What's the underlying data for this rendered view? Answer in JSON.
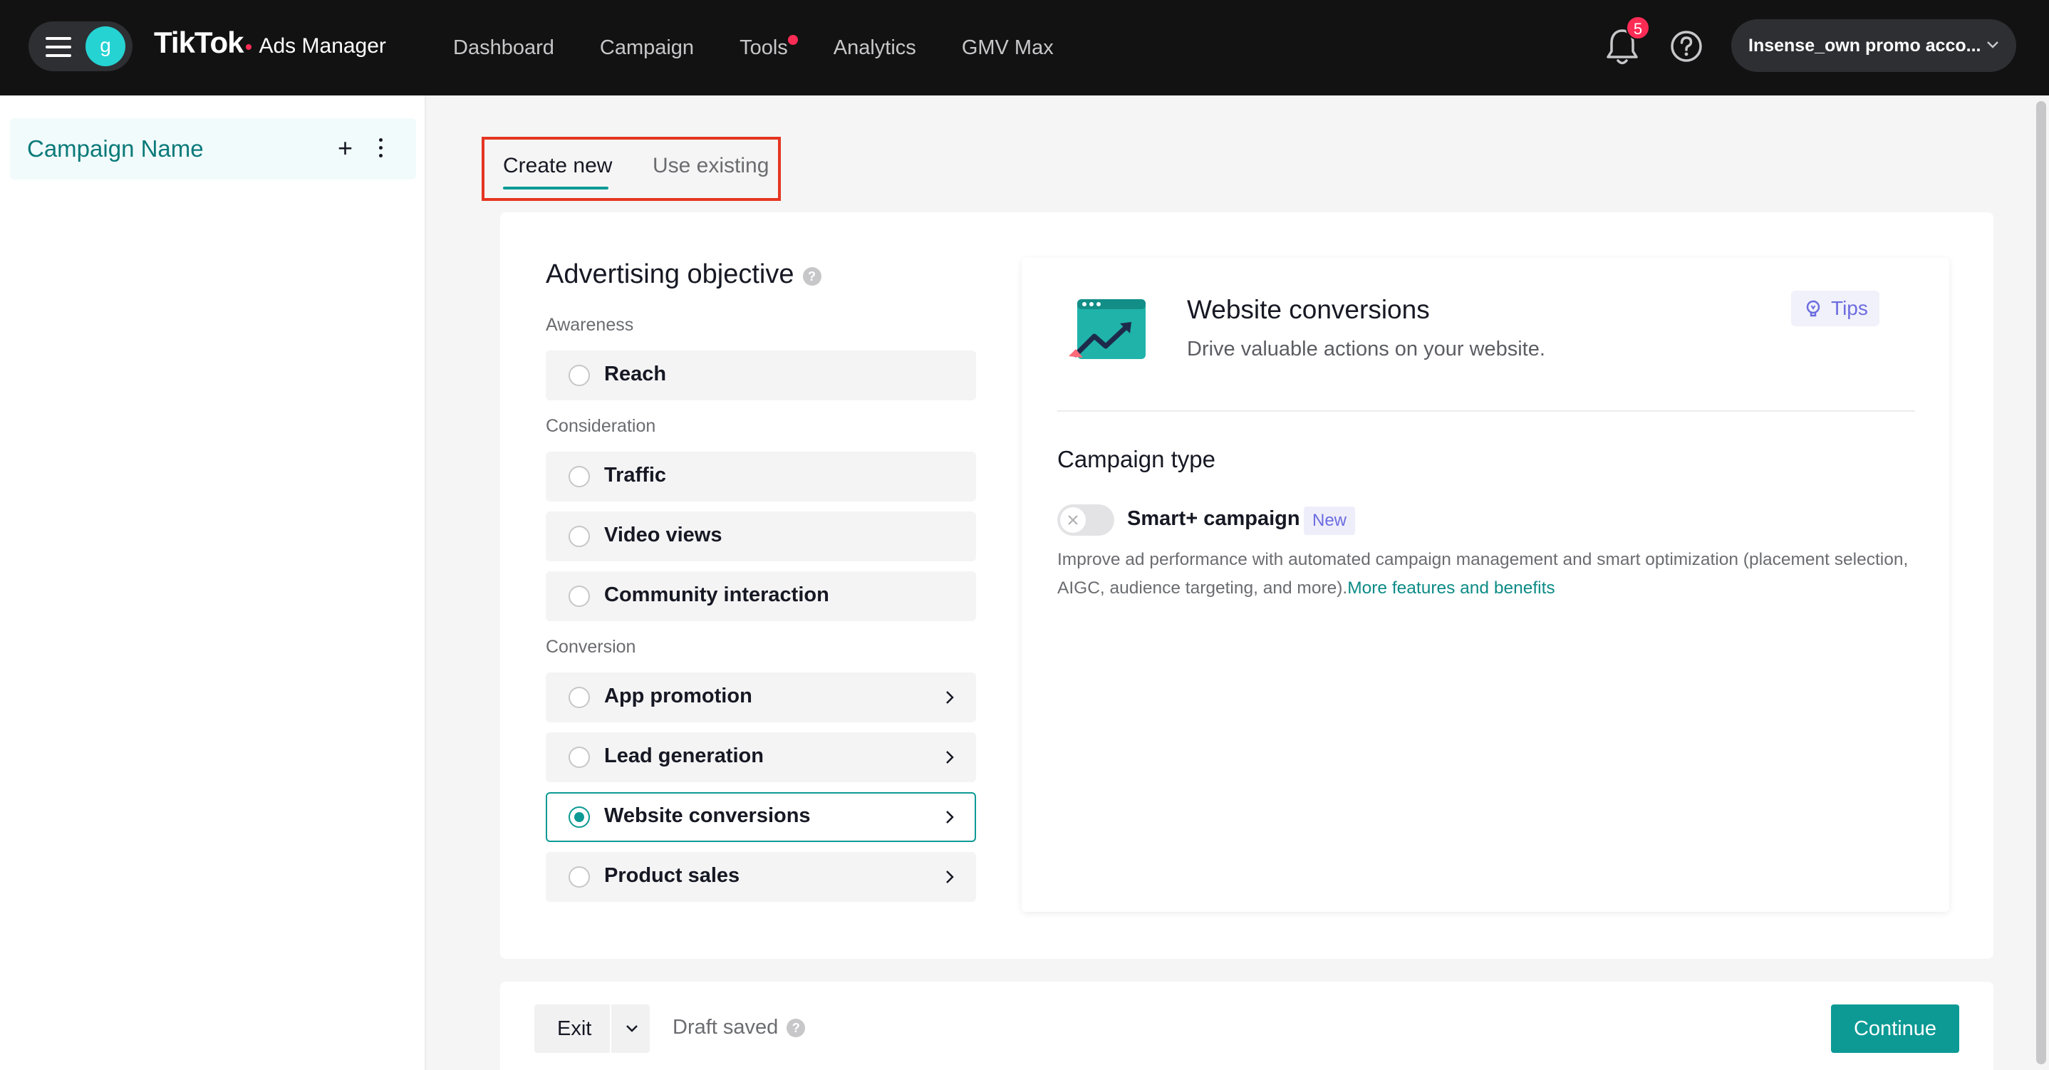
{
  "topbar": {
    "avatar_letter": "g",
    "brand_main": "TikTok",
    "brand_sub": "Ads Manager",
    "nav": [
      {
        "label": "Dashboard"
      },
      {
        "label": "Campaign"
      },
      {
        "label": "Tools",
        "dot": true
      },
      {
        "label": "Analytics"
      },
      {
        "label": "GMV Max"
      }
    ],
    "notification_count": "5",
    "account_label": "Insense_own promo acco..."
  },
  "sidebar": {
    "campaign_name": "Campaign Name",
    "add_symbol": "+"
  },
  "tabs": {
    "create_new": "Create new",
    "use_existing": "Use existing"
  },
  "objective": {
    "title": "Advertising objective",
    "help_symbol": "?",
    "groups": {
      "awareness": "Awareness",
      "consideration": "Consideration",
      "conversion": "Conversion"
    },
    "options": {
      "reach": "Reach",
      "traffic": "Traffic",
      "video_views": "Video views",
      "community_interaction": "Community interaction",
      "app_promotion": "App promotion",
      "lead_generation": "Lead generation",
      "website_conversions": "Website conversions",
      "product_sales": "Product sales"
    },
    "selected": "Website conversions"
  },
  "detail": {
    "title": "Website conversions",
    "description": "Drive valuable actions on your website.",
    "tips_label": "Tips",
    "campaign_type_title": "Campaign type",
    "smart_label": "Smart+ campaign",
    "new_badge": "New",
    "smart_desc": "Improve ad performance with automated campaign management and smart optimization (placement selection, AIGC, audience targeting, and more).",
    "smart_link": "More features and benefits",
    "smart_enabled": false
  },
  "bottombar": {
    "exit_label": "Exit",
    "draft_status": "Draft saved",
    "continue_label": "Continue"
  },
  "colors": {
    "accent": "#0d9a95",
    "topbar_bg": "#121212",
    "highlight_frame": "#e53522",
    "notification": "#fe2c55"
  }
}
